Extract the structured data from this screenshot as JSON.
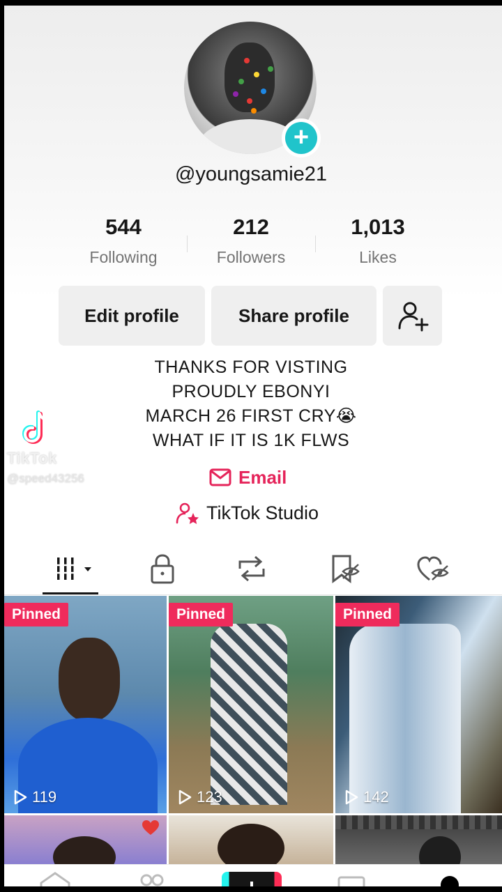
{
  "profile": {
    "username": "@youngsamie21",
    "stats": [
      {
        "value": "544",
        "label": "Following"
      },
      {
        "value": "212",
        "label": "Followers"
      },
      {
        "value": "1,013",
        "label": "Likes"
      }
    ],
    "buttons": {
      "edit": "Edit profile",
      "share": "Share profile",
      "add_friend_icon": "add-friend-icon"
    },
    "bio": [
      "THANKS FOR VISTING",
      "PROUDLY EBONYI",
      "MARCH 26 FIRST CRY😭",
      "WHAT IF IT IS 1K FLWS"
    ],
    "email_label": "Email",
    "studio_label": "TikTok Studio"
  },
  "watermark": {
    "brand": "TikTok",
    "handle": "@speed43256"
  },
  "tabs": [
    "videos-grid-icon",
    "lock-icon",
    "repost-icon",
    "favorites-icon",
    "liked-icon"
  ],
  "videos": [
    {
      "pinned_label": "Pinned",
      "views": "119"
    },
    {
      "pinned_label": "Pinned",
      "views": "123"
    },
    {
      "pinned_label": "Pinned",
      "views": "142"
    }
  ],
  "colors": {
    "accent": "#ef2b5c",
    "email": "#e5245a",
    "badge": "#20c4cb"
  }
}
